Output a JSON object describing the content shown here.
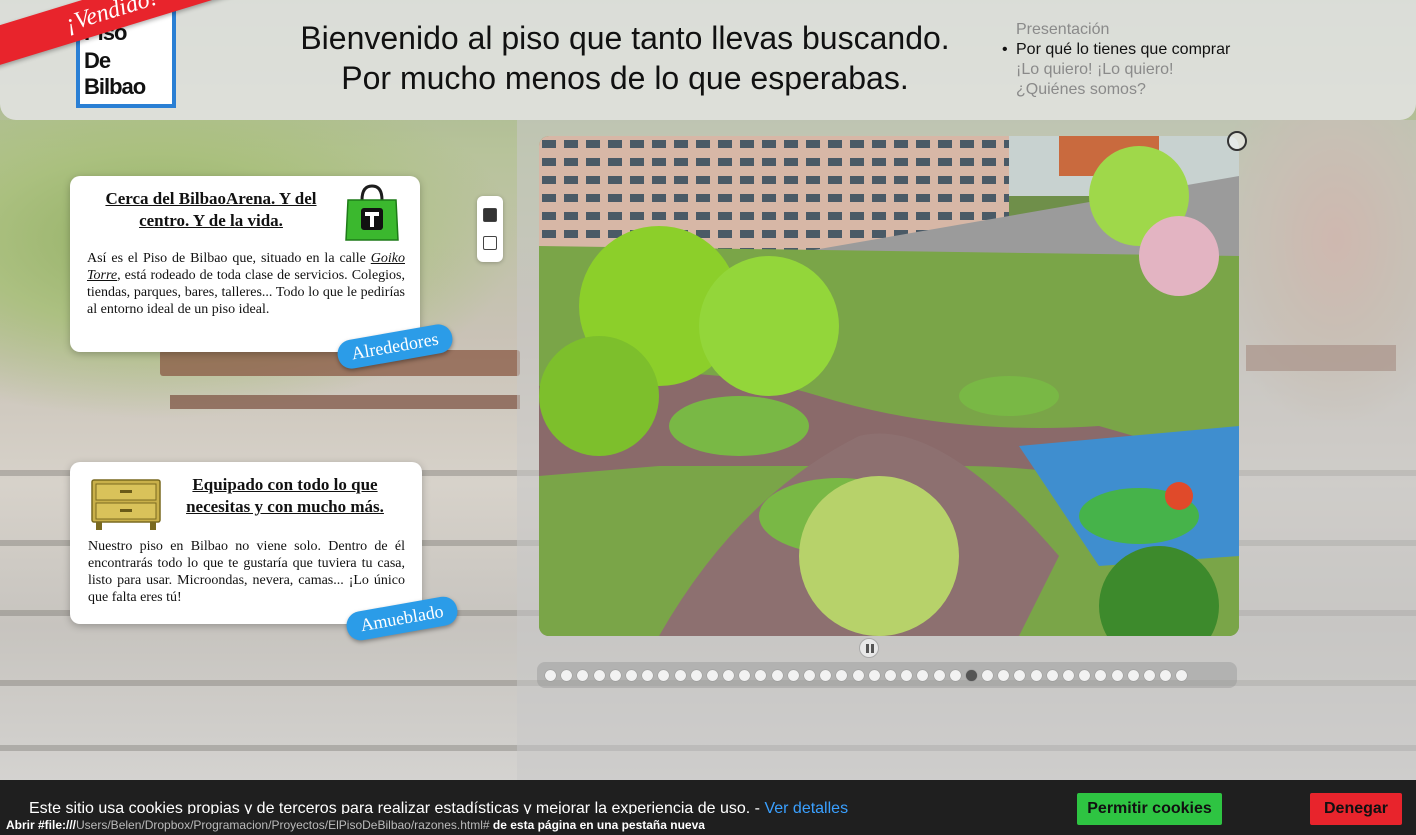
{
  "header": {
    "logo_lines": [
      "Piso",
      "De",
      "Bilbao"
    ],
    "ribbon": "¡Vendido!",
    "headline_1": "Bienvenido al piso que tanto llevas buscando.",
    "headline_2": "Por mucho menos de lo que esperabas."
  },
  "nav": {
    "items": [
      {
        "label": "Presentación",
        "active": false
      },
      {
        "label": "Por qué lo tienes que comprar",
        "active": true
      },
      {
        "label": "¡Lo quiero! ¡Lo quiero!",
        "active": false
      },
      {
        "label": "¿Quiénes somos?",
        "active": false
      }
    ]
  },
  "cards": [
    {
      "title": "Cerca del BilbaoArena. Y del centro. Y de la vida.",
      "body_1": "Así es el Piso de Bilbao que, situado en la calle ",
      "body_street": "Goiko Torre",
      "body_2": ", está rodeado de toda clase de servicios. Colegios, tiendas, parques, bares, talleres... Todo lo que le pedirías al entorno ideal de un piso ideal.",
      "tag": "Alrededores",
      "icon": "shopping-bag-icon"
    },
    {
      "title": "Equipado con todo lo que necesitas y con mucho más.",
      "body_1": "Nuestro piso en Bilbao no viene solo. Dentro de él encontrarás todo lo que te gustaría que tuviera tu casa, listo para usar. Microondas, nevera, camas... ¡Lo único que falta eres tú!",
      "tag": "Amueblado",
      "icon": "dresser-icon"
    }
  ],
  "vertical_pager": {
    "count": 2,
    "active_index": 0
  },
  "slideshow": {
    "dot_count": 40,
    "active_index": 26,
    "icons": [
      "close-circle-icon",
      "pause-icon"
    ]
  },
  "cookies": {
    "text": "Este sitio usa cookies propias y de terceros para realizar estadísticas y mejorar la experiencia de uso. - ",
    "link": "Ver detalles",
    "allow": "Permitir cookies",
    "deny": "Denegar"
  },
  "status": {
    "prefix": "Abrir #file:///",
    "path": "Users/Belen/Dropbox/Programacion/Proyectos/ElPisoDeBilbao/razones.html#",
    "suffix": " de esta página en una pestaña nueva"
  },
  "colors": {
    "ribbon": "#e8242c",
    "logo_border": "#2a7fd4",
    "tag": "#2b9ce8",
    "allow": "#2ec442",
    "deny": "#e8242c",
    "link": "#3aa0ff"
  }
}
